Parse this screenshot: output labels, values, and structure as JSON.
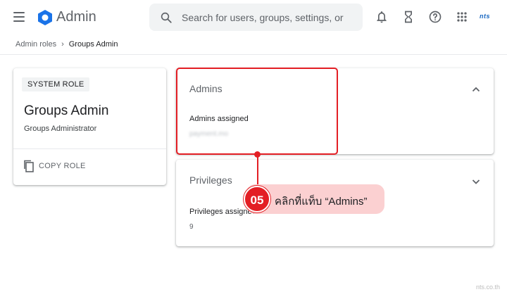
{
  "header": {
    "app_title": "Admin",
    "search_placeholder": "Search for users, groups, settings, or",
    "brand_logo_text": "nts"
  },
  "breadcrumb": {
    "items": [
      "Admin roles",
      "Groups Admin"
    ],
    "separator": "›"
  },
  "role_card": {
    "chip_label": "SYSTEM ROLE",
    "name": "Groups Admin",
    "description": "Groups Administrator",
    "copy_label": "COPY ROLE"
  },
  "admins_section": {
    "title": "Admins",
    "assigned_label": "Admins assigned",
    "assigned_value": "payment.mo",
    "expanded": true
  },
  "privileges_section": {
    "title": "Privileges",
    "assigned_label": "Privileges assigned",
    "assigned_value": "9",
    "expanded": false
  },
  "annotation": {
    "step_number": "05",
    "text": "คลิกที่แท็บ “Admins”"
  },
  "watermark": "nts.co.th",
  "colors": {
    "accent_red": "#e31e24",
    "callout_pink": "#fbd0d1",
    "google_blue": "#1a73e8",
    "text_secondary": "#5f6368"
  },
  "icons": {
    "menu": "menu-icon",
    "logo": "admin-logo-icon",
    "search": "search-icon",
    "notifications": "bell-icon",
    "tasks": "hourglass-icon",
    "help": "help-icon",
    "apps": "apps-grid-icon",
    "copy": "copy-icon",
    "collapse": "chevron-up-icon",
    "expand": "chevron-down-icon"
  }
}
